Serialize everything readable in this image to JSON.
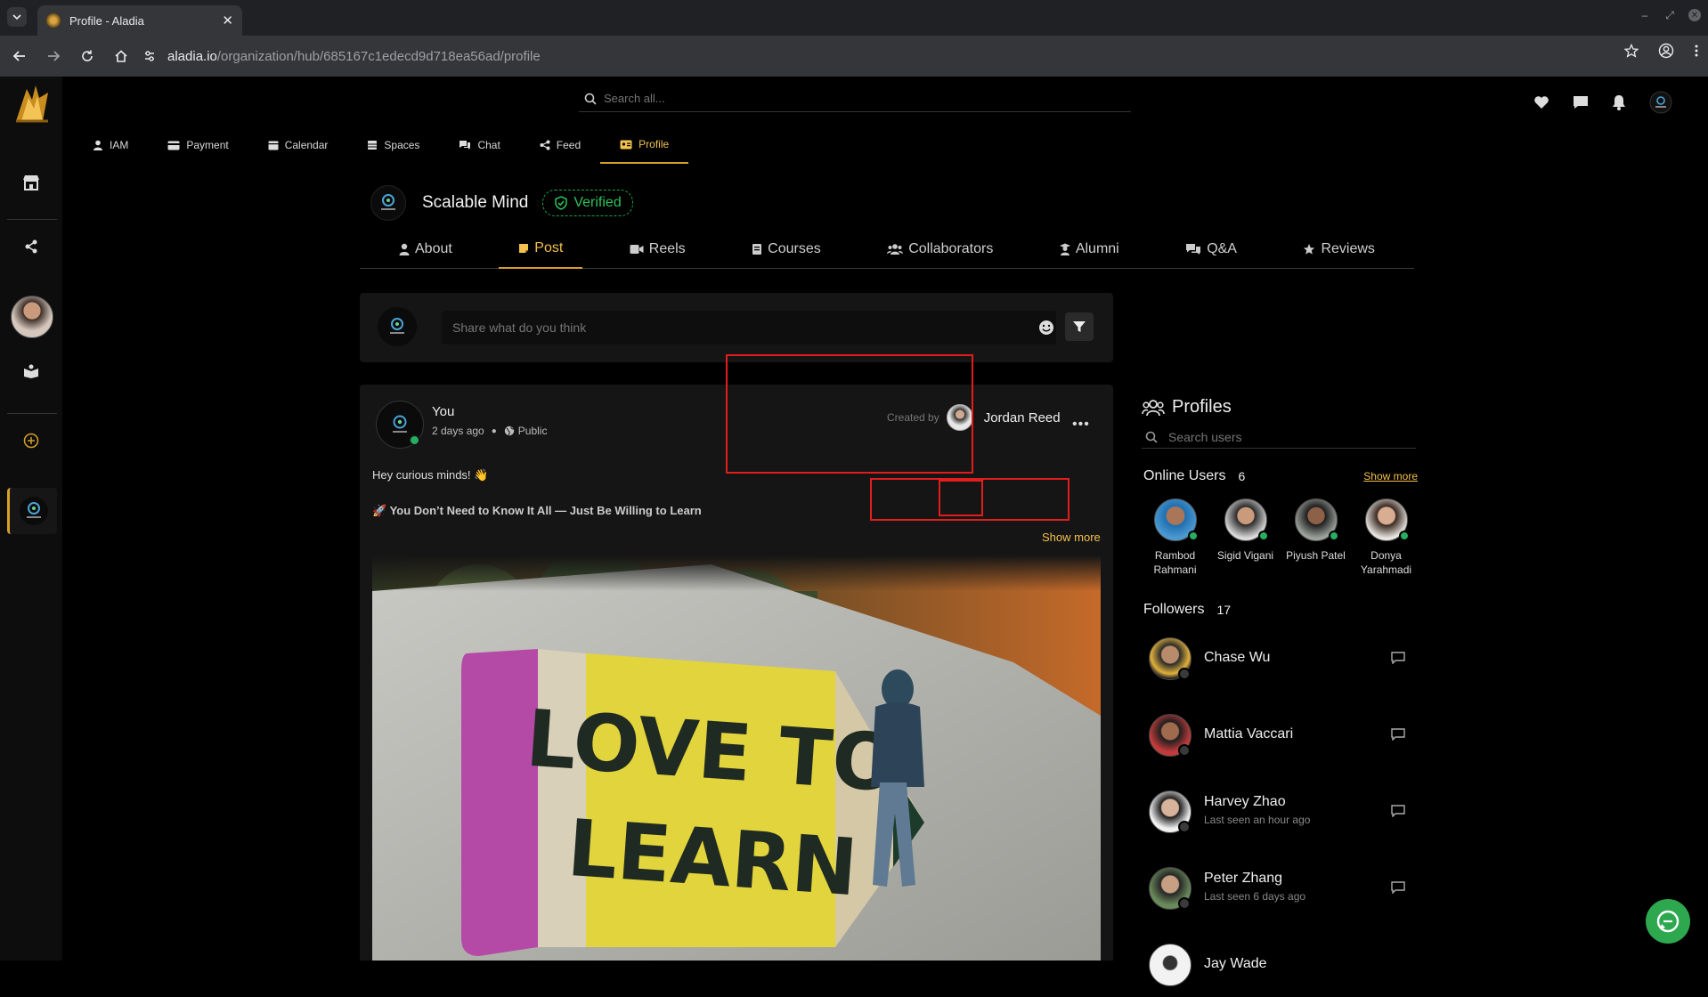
{
  "browser": {
    "tab_title": "Profile - Aladia",
    "url_host": "aladia.io",
    "url_path": "/organization/hub/685167c1edecd9d718ea56ad/profile"
  },
  "app": {
    "search_placeholder": "Search all...",
    "main_nav": [
      {
        "label": "IAM",
        "icon": "user-icon"
      },
      {
        "label": "Payment",
        "icon": "credit-card-icon"
      },
      {
        "label": "Calendar",
        "icon": "calendar-icon"
      },
      {
        "label": "Spaces",
        "icon": "spaces-icon"
      },
      {
        "label": "Chat",
        "icon": "chat-icon"
      },
      {
        "label": "Feed",
        "icon": "share-icon"
      },
      {
        "label": "Profile",
        "icon": "id-card-icon",
        "active": true
      }
    ],
    "accent_color": "#d4a02a",
    "verified_color": "#2ec25a"
  },
  "org": {
    "name": "Scalable Mind",
    "badge": "Verified"
  },
  "subtabs": [
    {
      "label": "About"
    },
    {
      "label": "Post",
      "active": true
    },
    {
      "label": "Reels"
    },
    {
      "label": "Courses"
    },
    {
      "label": "Collaborators"
    },
    {
      "label": "Alumni"
    },
    {
      "label": "Q&A"
    },
    {
      "label": "Reviews"
    }
  ],
  "composer": {
    "placeholder": "Share what do you think"
  },
  "post": {
    "author": "You",
    "time": "2 days ago",
    "visibility": "Public",
    "created_by_label": "Created by",
    "creator_name": "Jordan Reed",
    "text_line1": "Hey curious minds! 👋",
    "text_line2": "🚀 You Don’t Need to Know It All — Just Be Willing to Learn",
    "show_more": "Show more",
    "image_sign_line1": "LOVE TO",
    "image_sign_line2": "LEARN"
  },
  "profiles_panel": {
    "title": "Profiles",
    "search_placeholder": "Search users",
    "online_users_label": "Online Users",
    "online_users_count": "6",
    "show_more": "Show more",
    "online_users": [
      {
        "name": "Rambod Rahmani"
      },
      {
        "name": "Sigid Vigani"
      },
      {
        "name": "Piyush Patel"
      },
      {
        "name": "Donya Yarahmadi"
      }
    ],
    "followers_label": "Followers",
    "followers_count": "17",
    "followers": [
      {
        "name": "Chase Wu",
        "status": ""
      },
      {
        "name": "Mattia Vaccari",
        "status": ""
      },
      {
        "name": "Harvey Zhao",
        "status": "Last seen an hour ago"
      },
      {
        "name": "Peter Zhang",
        "status": "Last seen 6 days ago"
      },
      {
        "name": "Jay Wade",
        "status": ""
      }
    ]
  }
}
